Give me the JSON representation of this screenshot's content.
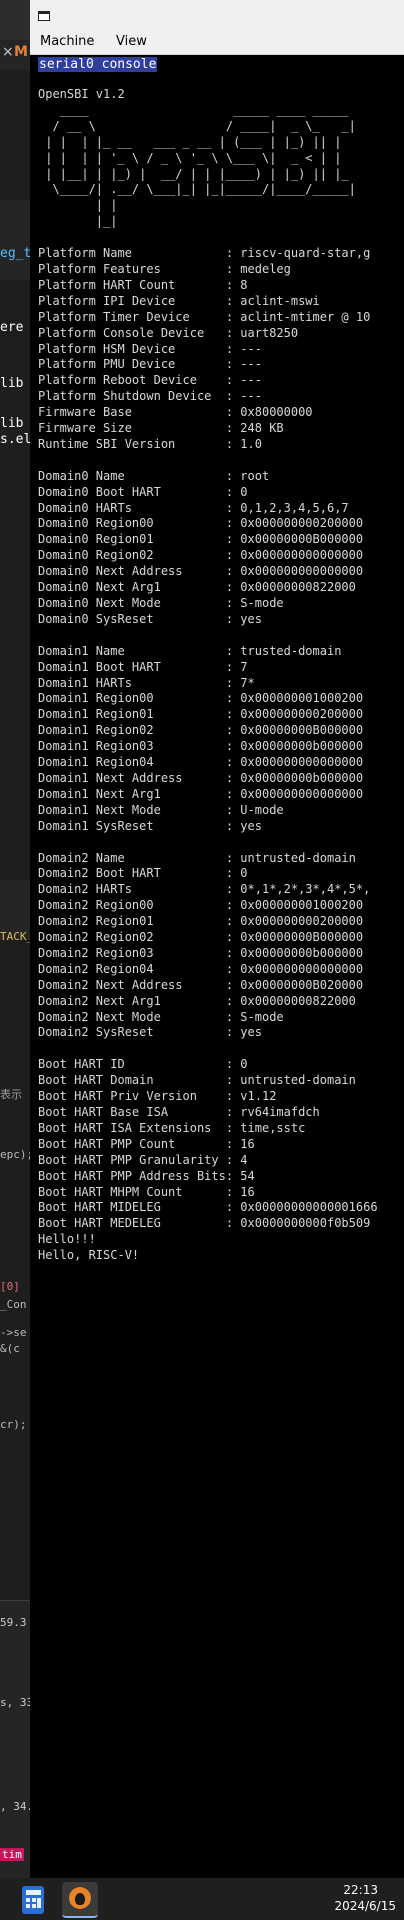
{
  "qemu": {
    "menu": [
      "Machine",
      "View"
    ],
    "console_tab": "serial0 console",
    "console_lines": [
      "OpenSBI v1.2",
      "   ____                    _____ ____ _____",
      "  / __ \\                  / ____|  _ \\_   _|",
      " | |  | |_ __   ___ _ __ | (___ | |_) || |",
      " | |  | | '_ \\ / _ \\ '_ \\ \\___ \\|  _ < | |",
      " | |__| | |_) |  __/ | | |____) | |_) || |_",
      "  \\____/| .__/ \\___|_| |_|_____/|____/_____|",
      "        | |",
      "        |_|",
      "",
      "Platform Name             : riscv-quard-star,g",
      "Platform Features         : medeleg",
      "Platform HART Count       : 8",
      "Platform IPI Device       : aclint-mswi",
      "Platform Timer Device     : aclint-mtimer @ 10",
      "Platform Console Device   : uart8250",
      "Platform HSM Device       : ---",
      "Platform PMU Device       : ---",
      "Platform Reboot Device    : ---",
      "Platform Shutdown Device  : ---",
      "Firmware Base             : 0x80000000",
      "Firmware Size             : 248 KB",
      "Runtime SBI Version       : 1.0",
      "",
      "Domain0 Name              : root",
      "Domain0 Boot HART         : 0",
      "Domain0 HARTs             : 0,1,2,3,4,5,6,7",
      "Domain0 Region00          : 0x000000000200000",
      "Domain0 Region01          : 0x00000000B000000",
      "Domain0 Region02          : 0x000000000000000",
      "Domain0 Next Address      : 0x000000000000000",
      "Domain0 Next Arg1         : 0x00000000822000",
      "Domain0 Next Mode         : S-mode",
      "Domain0 SysReset          : yes",
      "",
      "Domain1 Name              : trusted-domain",
      "Domain1 Boot HART         : 7",
      "Domain1 HARTs             : 7*",
      "Domain1 Region00          : 0x000000001000200",
      "Domain1 Region01          : 0x000000000200000",
      "Domain1 Region02          : 0x00000000B000000",
      "Domain1 Region03          : 0x00000000b000000",
      "Domain1 Region04          : 0x000000000000000",
      "Domain1 Next Address      : 0x00000000b000000",
      "Domain1 Next Arg1         : 0x000000000000000",
      "Domain1 Next Mode         : U-mode",
      "Domain1 SysReset          : yes",
      "",
      "Domain2 Name              : untrusted-domain",
      "Domain2 Boot HART         : 0",
      "Domain2 HARTs             : 0*,1*,2*,3*,4*,5*,",
      "Domain2 Region00          : 0x000000001000200",
      "Domain2 Region01          : 0x000000000200000",
      "Domain2 Region02          : 0x00000000B000000",
      "Domain2 Region03          : 0x00000000b000000",
      "Domain2 Region04          : 0x000000000000000",
      "Domain2 Next Address      : 0x00000000B020000",
      "Domain2 Next Arg1         : 0x00000000822000",
      "Domain2 Next Mode         : S-mode",
      "Domain2 SysReset          : yes",
      "",
      "Boot HART ID              : 0",
      "Boot HART Domain          : untrusted-domain",
      "Boot HART Priv Version    : v1.12",
      "Boot HART Base ISA        : rv64imafdch",
      "Boot HART ISA Extensions  : time,sstc",
      "Boot HART PMP Count       : 16",
      "Boot HART PMP Granularity : 4",
      "Boot HART PMP Address Bits: 54",
      "Boot HART MHPM Count      : 16",
      "Boot HART MIDELEG         : 0x00000000000001666",
      "Boot HART MEDELEG         : 0x0000000000f0b509",
      "Hello!!!",
      "Hello, RISC-V!"
    ]
  },
  "background_editor": {
    "fragments": [
      {
        "text": "eg_t",
        "color": "#4fc1ff"
      },
      {
        "text": "ere",
        "color": "#ffffff"
      },
      {
        "text": "lib",
        "color": "#ffffff"
      },
      {
        "text": "lib",
        "color": "#ffffff"
      },
      {
        "text": "s.el",
        "color": "#ffffff"
      },
      {
        "text": "TACK_",
        "color": "#dcb95a"
      },
      {
        "text": "表示",
        "color": "#9d9d9d"
      },
      {
        "text": "epc);",
        "color": "#bbbbbb"
      },
      {
        "text": "[0] ",
        "color": "#e06c75"
      },
      {
        "text": "_Con",
        "color": "#bbbbbb"
      },
      {
        "text": "->se",
        "color": "#bbbbbb"
      },
      {
        "text": "&(c",
        "color": "#bbbbbb"
      },
      {
        "text": "cr);",
        "color": "#bbbbbb"
      },
      {
        "text": "59.3",
        "color": "#cccccc"
      },
      {
        "text": "s, 33",
        "color": "#cccccc"
      },
      {
        "text": ", 34.",
        "color": "#cccccc"
      },
      {
        "text": "tim",
        "color": "#ffffff"
      }
    ]
  },
  "taskbar": {
    "time": "22:13",
    "date": "2024/6/15",
    "icons": [
      "calculator-icon",
      "qemu-icon"
    ]
  }
}
